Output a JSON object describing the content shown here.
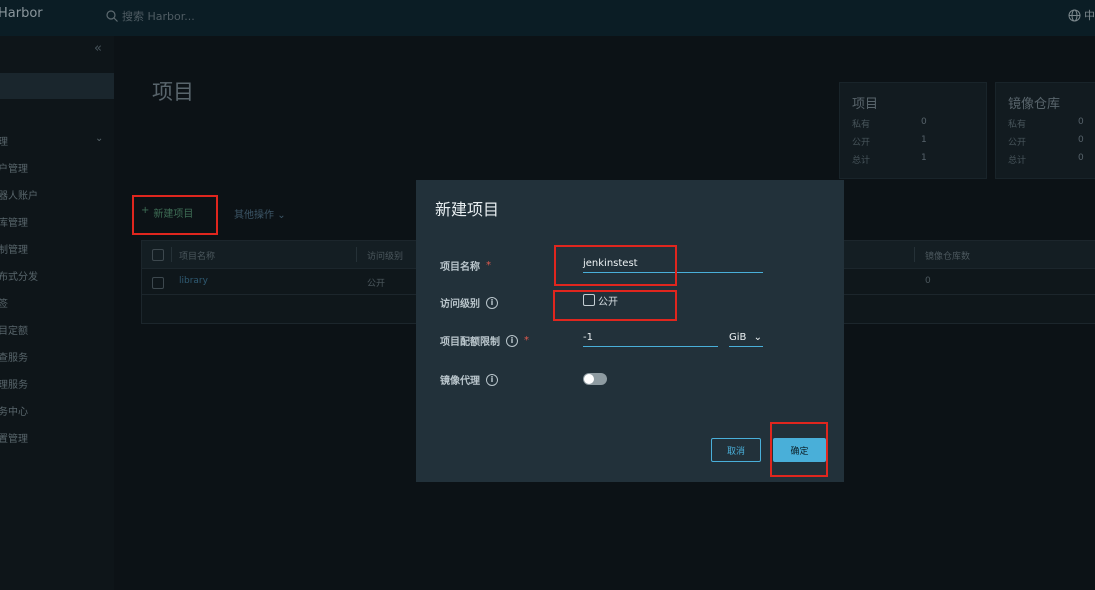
{
  "header": {
    "brand": "Harbor",
    "search_placeholder": "搜索 Harbor...",
    "lang_label": "中"
  },
  "sidebar": {
    "collapse_label": "«",
    "items": [
      {
        "label": "理"
      },
      {
        "label": "户管理"
      },
      {
        "label": "器人账户"
      },
      {
        "label": "库管理"
      },
      {
        "label": "制管理"
      },
      {
        "label": "布式分发"
      },
      {
        "label": "签"
      },
      {
        "label": "目定额"
      },
      {
        "label": "查服务"
      },
      {
        "label": "理服务"
      },
      {
        "label": "务中心"
      },
      {
        "label": "置管理"
      }
    ]
  },
  "main": {
    "title": "项目",
    "new_project": "新建项目",
    "other_ops": "其他操作"
  },
  "stats": {
    "projects": {
      "title": "项目",
      "private_label": "私有",
      "private": "0",
      "public_label": "公开",
      "public": "1",
      "total_label": "总计",
      "total": "1"
    },
    "repos": {
      "title": "镜像仓库",
      "private_label": "私有",
      "private": "0",
      "public_label": "公开",
      "public": "0",
      "total_label": "总计",
      "total": "0"
    }
  },
  "table": {
    "headers": [
      "项目名称",
      "访问级别",
      "镜像仓库数"
    ],
    "rows": [
      {
        "name": "library",
        "access": "公开",
        "repo_count": "0"
      }
    ]
  },
  "dialog": {
    "title": "新建项目",
    "name_label": "项目名称",
    "name_value": "jenkinstest",
    "access_label": "访问级别",
    "public_label": "公开",
    "public_checked": false,
    "quota_label": "项目配额限制",
    "quota_value": "-1",
    "quota_unit": "GiB",
    "proxy_label": "镜像代理",
    "proxy_enabled": false,
    "cancel_label": "取消",
    "ok_label": "确定"
  },
  "colors": {
    "accent": "#49afd9",
    "required": "#e05a4e",
    "annotation": "#e0261e",
    "dialog_bg": "#22313a"
  }
}
